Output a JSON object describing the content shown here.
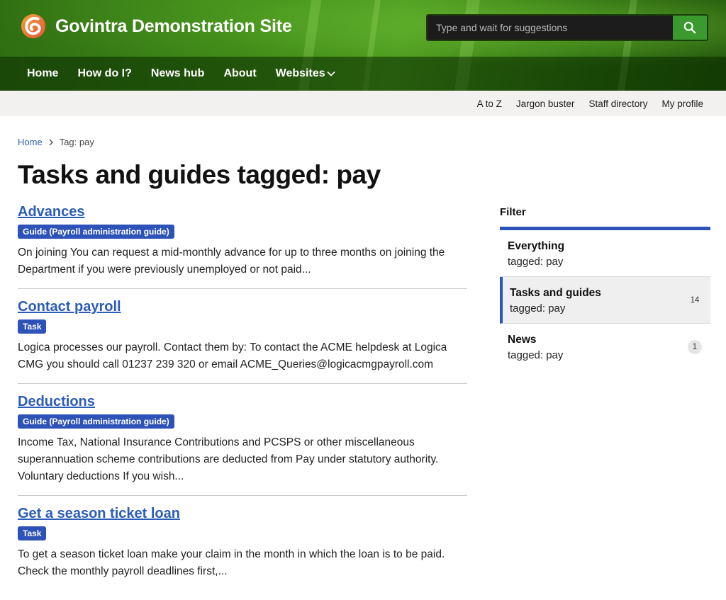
{
  "header": {
    "site_title": "Govintra Demonstration Site",
    "search_placeholder": "Type and wait for suggestions",
    "nav": [
      {
        "label": "Home"
      },
      {
        "label": "How do I?"
      },
      {
        "label": "News hub"
      },
      {
        "label": "About"
      },
      {
        "label": "Websites",
        "has_dropdown": true
      }
    ]
  },
  "utility_links": [
    "A to Z",
    "Jargon buster",
    "Staff directory",
    "My profile"
  ],
  "breadcrumb": {
    "home": "Home",
    "current": "Tag: pay"
  },
  "page_title": "Tasks and guides tagged: pay",
  "results": [
    {
      "title": "Advances",
      "badge": "Guide (Payroll administration guide)",
      "excerpt": "On joining You can request a mid-monthly advance for up to three months on joining the Department if you were previously unemployed or not paid..."
    },
    {
      "title": "Contact payroll",
      "badge": "Task",
      "excerpt": "Logica processes our payroll. Contact them by: To contact the ACME helpdesk at Logica CMG you should call 01237 239 320 or email ACME_Queries@logicacmgpayroll.com"
    },
    {
      "title": "Deductions",
      "badge": "Guide (Payroll administration guide)",
      "excerpt": "Income Tax, National Insurance Contributions and PCSPS or other miscellaneous superannuation scheme contributions are deducted from Pay under statutory authority. Voluntary deductions If you wish..."
    },
    {
      "title": "Get a season ticket loan",
      "badge": "Task",
      "excerpt": "To get a season ticket loan make your claim in the month in which the loan is to be paid. Check the monthly payroll deadlines first,..."
    }
  ],
  "filter": {
    "heading": "Filter",
    "items": [
      {
        "label": "Everything",
        "sub": "tagged: pay",
        "count": "",
        "active": false
      },
      {
        "label": "Tasks and guides",
        "sub": "tagged: pay",
        "count": "14",
        "active": true
      },
      {
        "label": "News",
        "sub": "tagged: pay",
        "count": "1",
        "active": false
      }
    ]
  },
  "colors": {
    "accent_blue": "#2d52b8",
    "link_blue": "#2b5cb8",
    "search_button_green": "#3a9a2e"
  }
}
